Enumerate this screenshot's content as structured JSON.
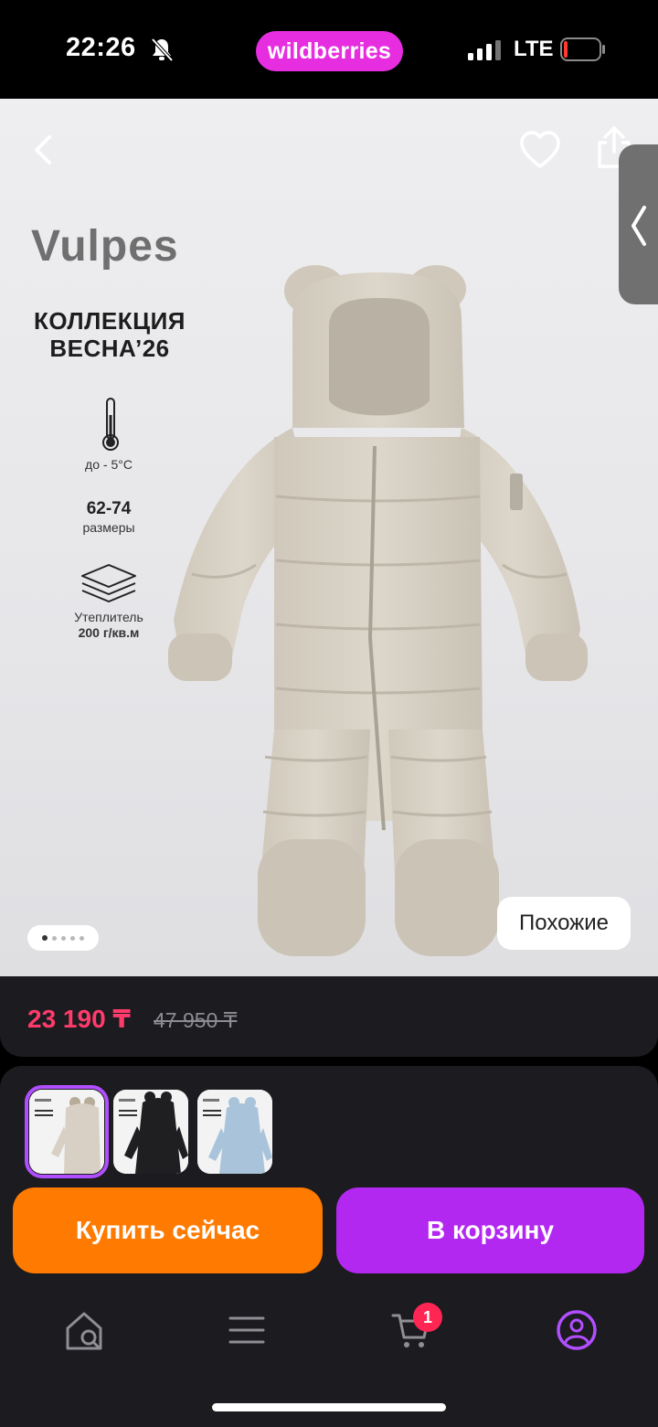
{
  "status_bar": {
    "time": "22:26",
    "brand": "wildberries",
    "network": "LTE",
    "icons": [
      "bell-slash-icon",
      "signal-icon",
      "battery-icon"
    ]
  },
  "hero": {
    "icons": [
      "back-icon",
      "heart-icon",
      "share-icon",
      "chevron-left-icon"
    ],
    "brand_logo": "Vulpes",
    "collection_line1": "КОЛЛЕКЦИЯ",
    "collection_line2": "ВЕСНА’26",
    "temp_label": "до - 5°С",
    "size_value": "62-74",
    "size_label": "размеры",
    "insul_label": "Утеплитель",
    "insul_value": "200 г/кв.м",
    "similar_label": "Похожие",
    "slide_count": 5,
    "slide_active": 1
  },
  "price": {
    "current": "23 190 ₸",
    "old": "47 950 ₸"
  },
  "variants": [
    {
      "color": "#d8d0c4",
      "selected": true
    },
    {
      "color": "#1f1f22",
      "selected": false
    },
    {
      "color": "#a9c4da",
      "selected": false
    }
  ],
  "actions": {
    "buy_label": "Купить сейчас",
    "cart_label": "В корзину"
  },
  "bottom_nav": {
    "items": [
      "home-search-icon",
      "menu-icon",
      "cart-icon",
      "profile-icon"
    ],
    "cart_badge": "1",
    "active_color": "#b14eff"
  },
  "colors": {
    "accent_purple": "#b328f0",
    "accent_orange": "#ff7a00",
    "price_red": "#ff3b6b",
    "brand_pink": "#e62ee0"
  }
}
